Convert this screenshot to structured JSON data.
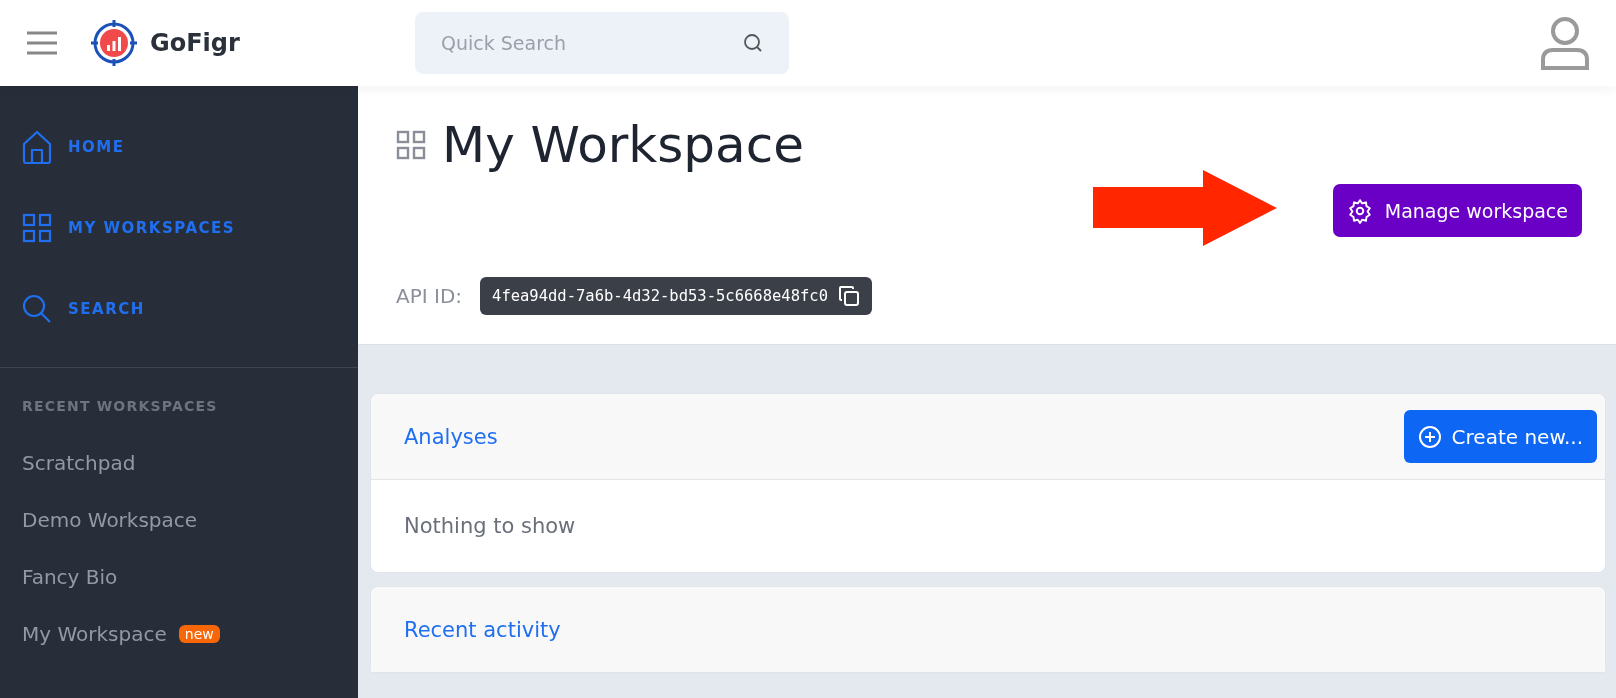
{
  "header": {
    "logo_text": "GoFigr",
    "search": {
      "placeholder": "Quick Search"
    }
  },
  "sidebar": {
    "nav": [
      {
        "label": "HOME",
        "kind": "home"
      },
      {
        "label": "MY WORKSPACES",
        "kind": "grid"
      },
      {
        "label": "SEARCH",
        "kind": "search"
      }
    ],
    "recent_heading": "RECENT WORKSPACES",
    "recent": [
      {
        "label": "Scratchpad"
      },
      {
        "label": "Demo Workspace"
      },
      {
        "label": "Fancy Bio"
      },
      {
        "label": "My Workspace",
        "badge": "new"
      }
    ]
  },
  "page": {
    "title": "My Workspace",
    "manage_button": "Manage workspace",
    "api_label": "API ID:",
    "api_id": "4fea94dd-7a6b-4d32-bd53-5c6668e48fc0"
  },
  "cards": [
    {
      "title": "Analyses",
      "button": "Create new...",
      "body": "Nothing to show"
    },
    {
      "title": "Recent activity"
    }
  ]
}
